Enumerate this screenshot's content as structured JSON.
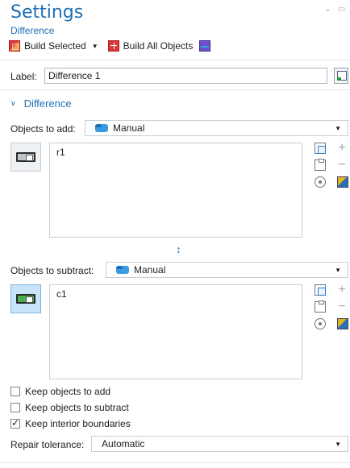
{
  "header": {
    "title": "Settings",
    "subtitle": "Difference"
  },
  "toolbar": {
    "build_selected": "Build Selected",
    "build_all": "Build All Objects"
  },
  "label_row": {
    "label": "Label:",
    "value": "Difference 1"
  },
  "section": {
    "title": "Difference"
  },
  "objects_to_add": {
    "label": "Objects to add:",
    "mode": "Manual",
    "items": [
      "r1"
    ]
  },
  "objects_to_subtract": {
    "label": "Objects to subtract:",
    "mode": "Manual",
    "items": [
      "c1"
    ]
  },
  "checkboxes": {
    "keep_add": {
      "label": "Keep objects to add",
      "checked": false
    },
    "keep_subtract": {
      "label": "Keep objects to subtract",
      "checked": false
    },
    "keep_interior": {
      "label": "Keep interior boundaries",
      "checked": true
    }
  },
  "repair": {
    "label": "Repair tolerance:",
    "value": "Automatic"
  },
  "colors": {
    "accent": "#1e6fb5",
    "build_red": "#d9383a",
    "active_toggle": "#c9e3f8"
  }
}
